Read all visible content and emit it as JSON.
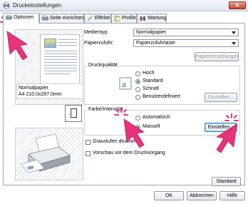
{
  "window": {
    "title": "Druckeinstellungen",
    "close_label": "✕"
  },
  "tabs": [
    {
      "label": "Optionen",
      "icon": "options-icon"
    },
    {
      "label": "Seite einrichten",
      "icon": "page-setup-icon"
    },
    {
      "label": "Effekte",
      "icon": "effects-icon"
    },
    {
      "label": "Profile",
      "icon": "profile-icon"
    },
    {
      "label": "Wartung",
      "icon": "maintenance-icon"
    }
  ],
  "preview": {
    "paper_info_line1": "Normalpapier",
    "paper_info_line2": "A4 210.0x297.0mm"
  },
  "fields": {
    "media_type_label": "Medientyp:",
    "media_type_value": "Normalpapier",
    "paper_source_label": "Papierzufuhr:",
    "paper_source_value": "Papierzufuhrtaste",
    "paper_settings_button": "Papiereinstellungen..."
  },
  "quality": {
    "title": "Druckqualität",
    "options": [
      "Hoch",
      "Standard",
      "Schnell",
      "Benutzerdefiniert"
    ],
    "selected": "Standard",
    "settings_button": "Einstellen..."
  },
  "color": {
    "title": "Farbe/Intensität",
    "options": [
      "Automatisch",
      "Manuell"
    ],
    "selected": "Manuell",
    "settings_button": "Einstellen..."
  },
  "checks": {
    "grayscale_label": "Graustufen drucken",
    "preview_label": "Vorschau vor dem Druckvorgang"
  },
  "buttons": {
    "standard": "Standard",
    "ok": "OK",
    "cancel": "Abbrechen",
    "help": "Hilfe"
  },
  "colors": {
    "accent_pink": "#e8337a",
    "title_gradient": "#dde6f1"
  }
}
